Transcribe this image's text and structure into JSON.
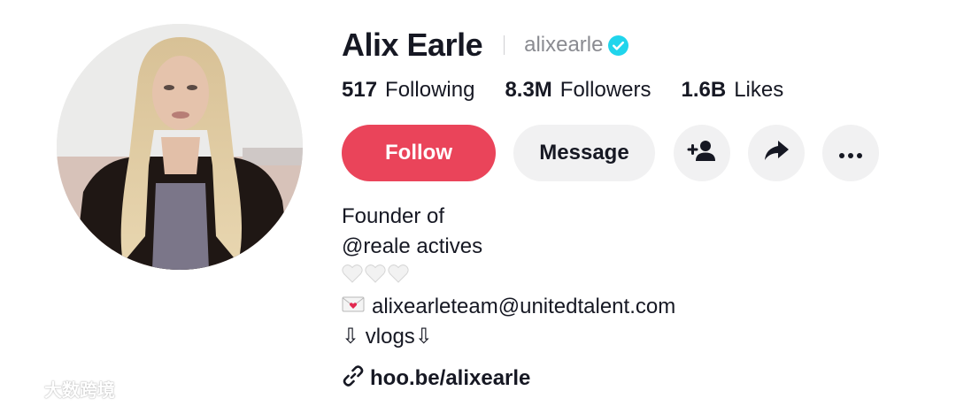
{
  "profile": {
    "display_name": "Alix Earle",
    "username": "alixearle",
    "verified": true,
    "avatar_alt": "profile photo"
  },
  "stats": [
    {
      "value": "517",
      "label": "Following"
    },
    {
      "value": "8.3M",
      "label": "Followers"
    },
    {
      "value": "1.6B",
      "label": "Likes"
    }
  ],
  "actions": {
    "follow_label": "Follow",
    "message_label": "Message",
    "icons": [
      "add-friend-icon",
      "share-icon",
      "more-icon"
    ]
  },
  "bio": {
    "line1": "Founder of",
    "line2": "@reale actives",
    "hearts": "🤍🤍🤍",
    "email": "alixearleteam@unitedtalent.com",
    "line5": "⇩ vlogs⇩"
  },
  "link": {
    "text": "hoo.be/alixearle"
  },
  "colors": {
    "follow_button": "#ea445a",
    "secondary_button": "#f1f1f2",
    "verified_badge": "#20d5ec",
    "text_primary": "#161823",
    "text_secondary": "#8a8b91"
  },
  "watermark": {
    "text": "大数跨境"
  }
}
